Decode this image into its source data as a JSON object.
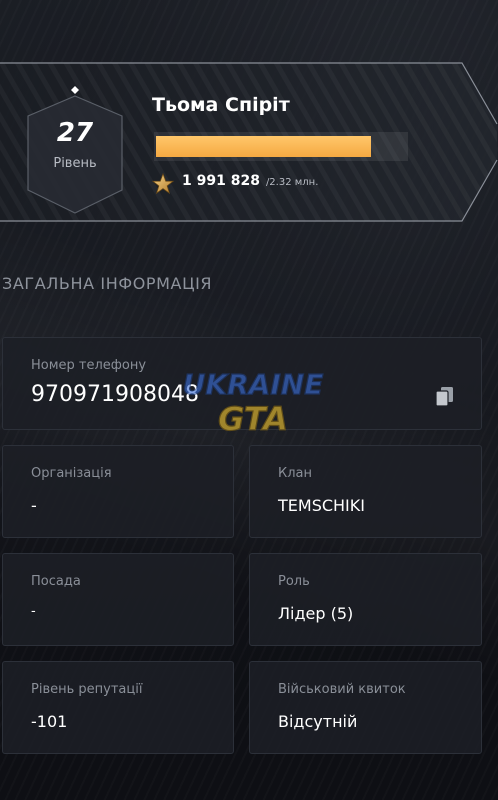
{
  "profile": {
    "name": "Тьома Спіріт",
    "level": "27",
    "level_label": "Рівень",
    "xp_current": "1 991 828",
    "xp_total": "/2.32 млн.",
    "xp_progress": 0.86,
    "accent_color": "#f5a942",
    "xp_icon": "star-icon"
  },
  "section": {
    "title": "ЗАГАЛЬНА ІНФОРМАЦІЯ"
  },
  "phone": {
    "label": "Номер телефону",
    "value": "970971908048",
    "copy_icon": "copy-icon"
  },
  "info": {
    "organization": {
      "label": "Організація",
      "value": "-"
    },
    "clan": {
      "label": "Клан",
      "value": "TEMSCHIKI"
    },
    "position": {
      "label": "Посада",
      "value": "-"
    },
    "role": {
      "label": "Роль",
      "value": "Лідер (5)"
    },
    "reputation": {
      "label": "Рівень репутації",
      "value": "-101"
    },
    "military_ticket": {
      "label": "Військовий квиток",
      "value": "Відсутній"
    }
  },
  "watermark": {
    "line1": "UKRAINE",
    "line2": "GTA"
  }
}
